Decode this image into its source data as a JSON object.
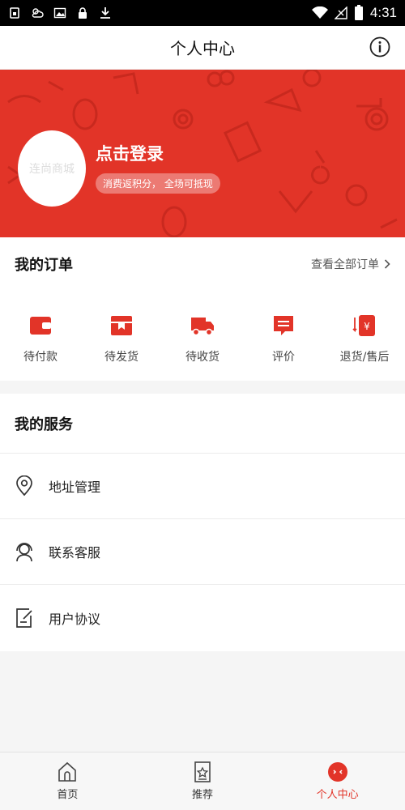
{
  "status_bar": {
    "time": "4:31",
    "icons": [
      "sim-icon",
      "weather-icon",
      "image-icon",
      "lock-icon",
      "download-icon",
      "wifi-icon",
      "signal-icon",
      "battery-icon"
    ]
  },
  "header": {
    "title": "个人中心",
    "info_icon": "info-icon"
  },
  "profile": {
    "avatar_text": "连尚商城",
    "login_label": "点击登录",
    "tagline": "消费返积分， 全场可抵现"
  },
  "orders": {
    "title": "我的订单",
    "view_all": "查看全部订单",
    "items": [
      {
        "label": "待付款",
        "icon": "wallet-icon"
      },
      {
        "label": "待发货",
        "icon": "box-icon"
      },
      {
        "label": "待收货",
        "icon": "truck-icon"
      },
      {
        "label": "评价",
        "icon": "comment-icon"
      },
      {
        "label": "退货/售后",
        "icon": "refund-icon"
      }
    ]
  },
  "services": {
    "title": "我的服务",
    "items": [
      {
        "label": "地址管理",
        "icon": "location-icon"
      },
      {
        "label": "联系客服",
        "icon": "headset-icon"
      },
      {
        "label": "用户协议",
        "icon": "document-icon"
      }
    ]
  },
  "tabbar": {
    "items": [
      {
        "label": "首页",
        "icon": "home-icon"
      },
      {
        "label": "推荐",
        "icon": "star-bookmark-icon"
      },
      {
        "label": "个人中心",
        "icon": "profile-face-icon",
        "active": true
      }
    ]
  },
  "colors": {
    "accent": "#e23428",
    "background": "#f5f5f5"
  }
}
